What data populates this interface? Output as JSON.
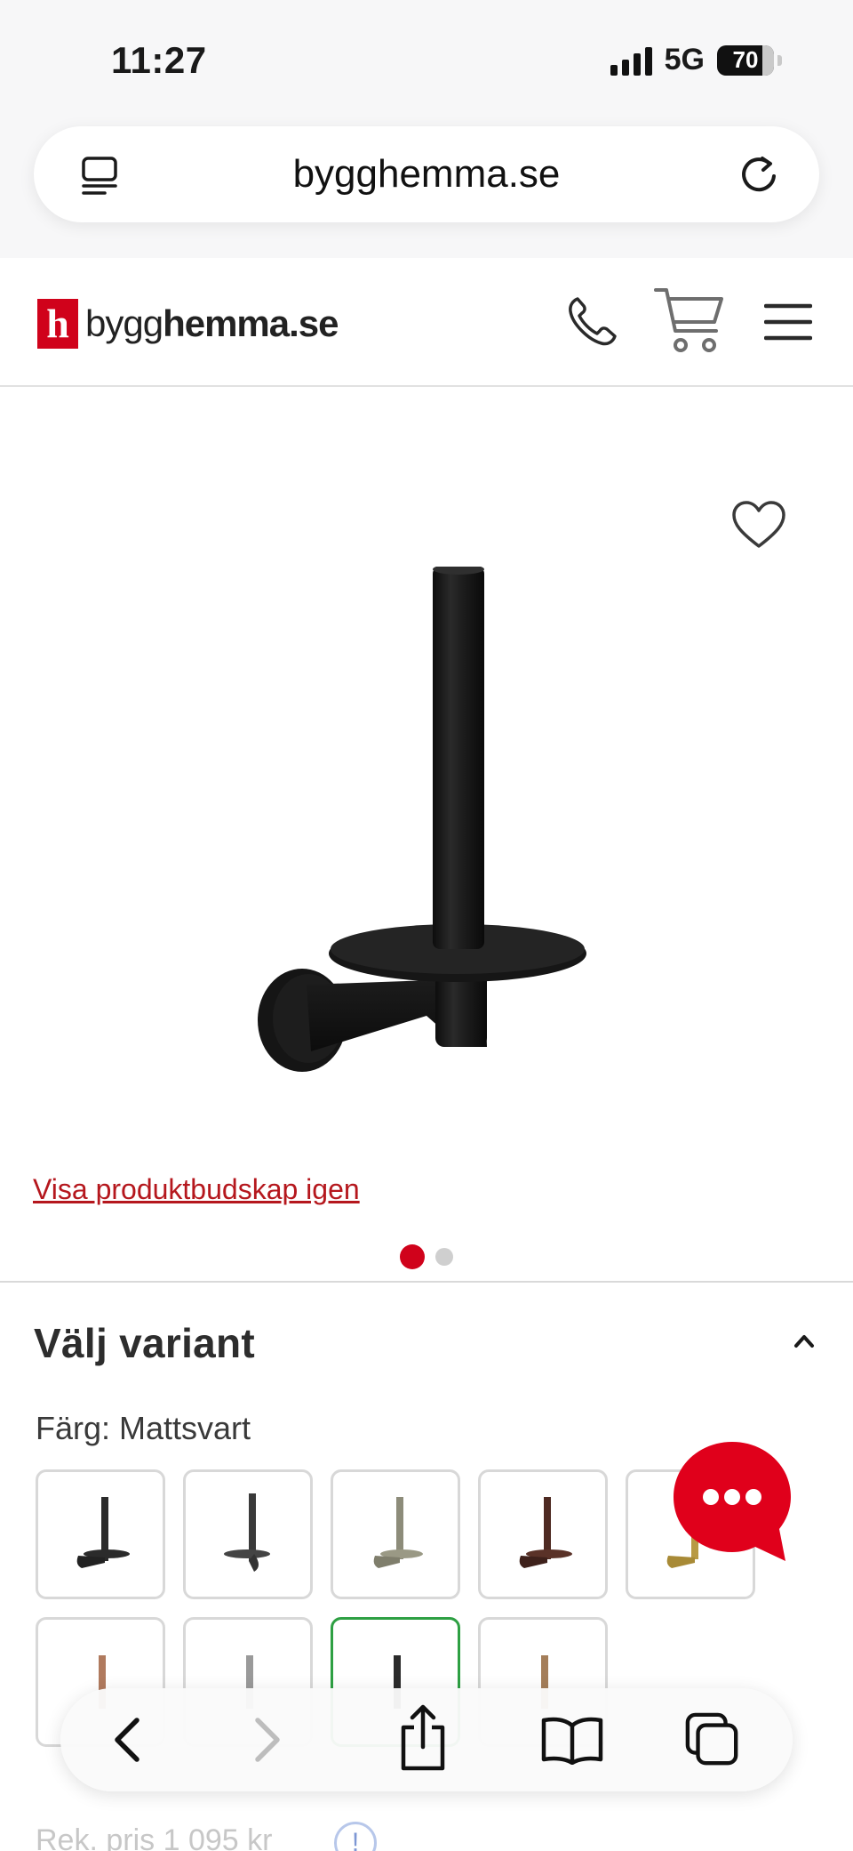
{
  "status_bar": {
    "time": "11:27",
    "network": "5G",
    "battery": "70"
  },
  "browser": {
    "url": "bygghemma.se",
    "left_icon": "reader-icon",
    "right_icon": "reload-icon"
  },
  "site_header": {
    "logo_mark": "h",
    "logo_text_light": "bygg",
    "logo_text_bold": "hemma.se",
    "icons": [
      "phone-icon",
      "cart-icon",
      "menu-icon"
    ]
  },
  "gallery": {
    "reshow_link": "Visa produktbudskap igen",
    "slide_count": 2,
    "active_slide": 1
  },
  "variant": {
    "title": "Välj variant",
    "color_label": "Färg: Mattsvart",
    "swatches": [
      {
        "name": "swatch-1",
        "tone": "#2b2b2b"
      },
      {
        "name": "swatch-2",
        "tone": "#3a3a3a"
      },
      {
        "name": "swatch-3",
        "tone": "#8d8c7a"
      },
      {
        "name": "swatch-4",
        "tone": "#4e2a22"
      },
      {
        "name": "swatch-5",
        "tone": "#b89a44"
      },
      {
        "name": "swatch-6",
        "tone": "#b07a5e"
      },
      {
        "name": "swatch-7",
        "tone": "#9a9a9a"
      },
      {
        "name": "swatch-8",
        "tone": "#2b2b2b",
        "selected": true
      },
      {
        "name": "swatch-9",
        "tone": "#a47e5a"
      }
    ]
  },
  "price": {
    "text": "Rek. pris 1 095 kr",
    "info": "!"
  },
  "colors": {
    "brand_red": "#d0021b",
    "link_red": "#b5171d",
    "selected_green": "#2ea043"
  }
}
